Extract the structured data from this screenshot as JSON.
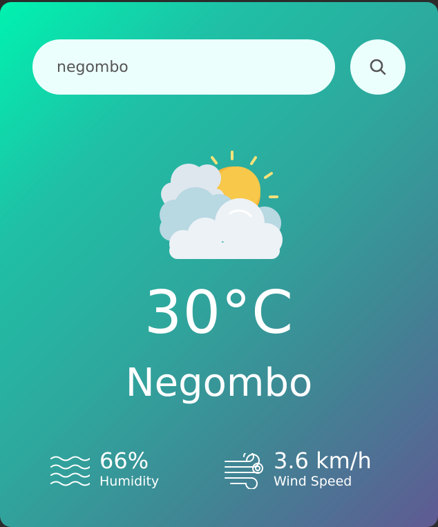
{
  "search": {
    "value": "negombo",
    "placeholder": "",
    "button_icon": "search-icon"
  },
  "weather": {
    "icon": "partly-cloudy-icon",
    "temperature": "30°C",
    "city": "Negombo"
  },
  "details": {
    "humidity": {
      "icon": "humidity-waves-icon",
      "value": "66%",
      "label": "Humidity"
    },
    "wind": {
      "icon": "wind-icon",
      "value": "3.6 km/h",
      "label": "Wind Speed"
    }
  },
  "colors": {
    "gradient_start": "#00f2b0",
    "gradient_end": "#5f5a93",
    "search_bg": "#ebfffc",
    "text": "#ffffff"
  }
}
